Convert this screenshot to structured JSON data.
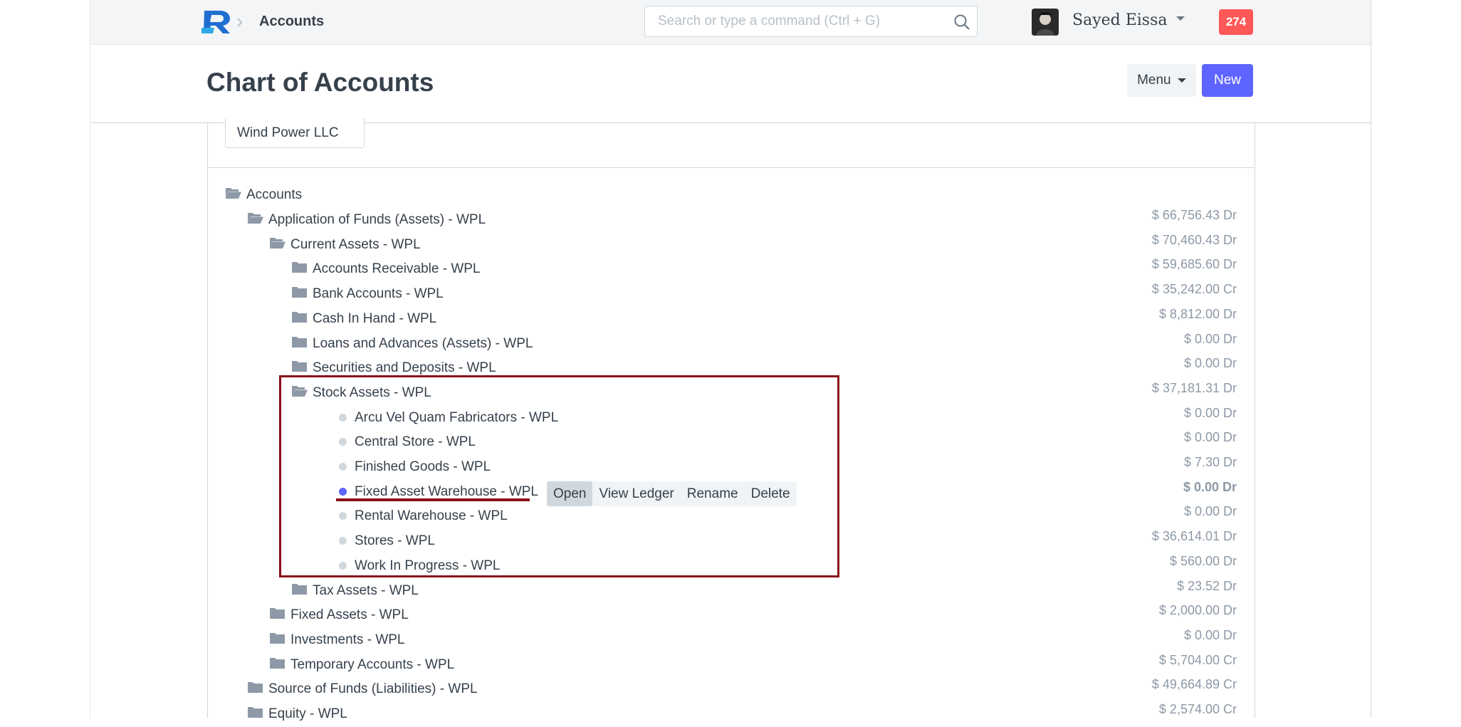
{
  "navbar": {
    "breadcrumb": "Accounts",
    "search_placeholder": "Search or type a command (Ctrl + G)",
    "user_name": "Sayed Eissa",
    "notification_count": "274"
  },
  "page": {
    "title": "Chart of Accounts",
    "menu_label": "Menu",
    "new_label": "New"
  },
  "filter": {
    "company": "Wind Power LLC"
  },
  "tree": {
    "root": "Accounts",
    "nodes": [
      {
        "label": "Application of Funds (Assets) - WPL",
        "balance": "$ 66,756.43 Dr",
        "level": 1,
        "open": true
      },
      {
        "label": "Current Assets - WPL",
        "balance": "$ 70,460.43 Dr",
        "level": 2,
        "open": true
      },
      {
        "label": "Accounts Receivable - WPL",
        "balance": "$ 59,685.60 Dr",
        "level": 3,
        "open": false
      },
      {
        "label": "Bank Accounts - WPL",
        "balance": "$ 35,242.00 Cr",
        "level": 3,
        "open": false
      },
      {
        "label": "Cash In Hand - WPL",
        "balance": "$ 8,812.00 Dr",
        "level": 3,
        "open": false
      },
      {
        "label": "Loans and Advances (Assets) - WPL",
        "balance": "$ 0.00 Dr",
        "level": 3,
        "open": false
      },
      {
        "label": "Securities and Deposits - WPL",
        "balance": "$ 0.00 Dr",
        "level": 3,
        "open": false
      },
      {
        "label": "Stock Assets - WPL",
        "balance": "$ 37,181.31 Dr",
        "level": 3,
        "open": true
      },
      {
        "label": "Arcu Vel Quam Fabricators - WPL",
        "balance": "$ 0.00 Dr",
        "level": 4,
        "leaf": true
      },
      {
        "label": "Central Store - WPL",
        "balance": "$ 0.00 Dr",
        "level": 4,
        "leaf": true
      },
      {
        "label": "Finished Goods - WPL",
        "balance": "$ 7.30 Dr",
        "level": 4,
        "leaf": true
      },
      {
        "label": "Fixed Asset Warehouse - WPL",
        "balance": "$ 0.00 Dr",
        "level": 4,
        "leaf": true,
        "selected": true
      },
      {
        "label": "Rental Warehouse - WPL",
        "balance": "$ 0.00 Dr",
        "level": 4,
        "leaf": true
      },
      {
        "label": "Stores - WPL",
        "balance": "$ 36,614.01 Dr",
        "level": 4,
        "leaf": true
      },
      {
        "label": "Work In Progress - WPL",
        "balance": "$ 560.00 Dr",
        "level": 4,
        "leaf": true
      },
      {
        "label": "Tax Assets - WPL",
        "balance": "$ 23.52 Dr",
        "level": 3,
        "open": false
      },
      {
        "label": "Fixed Assets - WPL",
        "balance": "$ 2,000.00 Dr",
        "level": 2,
        "open": false
      },
      {
        "label": "Investments - WPL",
        "balance": "$ 0.00 Dr",
        "level": 2,
        "open": false
      },
      {
        "label": "Temporary Accounts - WPL",
        "balance": "$ 5,704.00 Cr",
        "level": 2,
        "open": false
      },
      {
        "label": "Source of Funds (Liabilities) - WPL",
        "balance": "$ 49,664.89 Cr",
        "level": 1,
        "open": false
      },
      {
        "label": "Equity - WPL",
        "balance": "$ 2,574.00 Cr",
        "level": 1,
        "open": false
      }
    ]
  },
  "node_actions": [
    "Open",
    "View Ledger",
    "Rename",
    "Delete"
  ],
  "colors": {
    "primary": "#5e64ff",
    "annotation": "#8b0f1a",
    "notification": "#ff5858"
  }
}
